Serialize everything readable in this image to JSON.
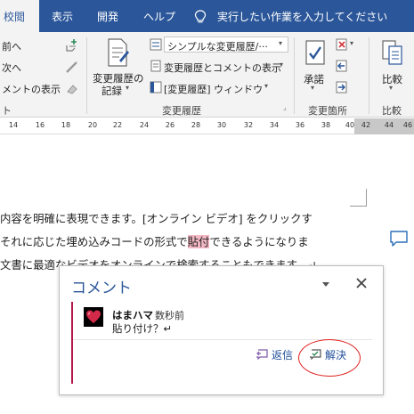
{
  "tabs": [
    {
      "label": "校閲",
      "active": true
    },
    {
      "label": "表示"
    },
    {
      "label": "開発"
    },
    {
      "label": "ヘルプ"
    }
  ],
  "tell_me": "実行したい作業を入力してください",
  "ribbon": {
    "partial_items": [
      "前へ",
      "次へ",
      "メントの表示"
    ],
    "partial_group_label": "ト",
    "track_changes": {
      "line1": "変更履歴の",
      "line2": "記録"
    },
    "markup_select": "シンプルな変更履歴/···",
    "show_markup": "変更履歴とコメントの表示",
    "reviewing_pane": "[変更履歴] ウィンドウ",
    "group_tracking": "変更履歴",
    "accept": "承諾",
    "group_changes": "変更箇所",
    "compare": "比較",
    "group_compare": "比較"
  },
  "ruler_ticks": [
    "14",
    "16",
    "18",
    "20",
    "22",
    "24",
    "26",
    "28",
    "30",
    "32",
    "34",
    "36",
    "38",
    "40",
    "42",
    "44",
    "46"
  ],
  "document": {
    "line1": "内容を明確に表現できます。[オンライン ビデオ] をクリックす",
    "line2_before": "それに応じた埋め込みコードの形式で",
    "line2_highlight": "貼付",
    "line2_after": "できるようになりま",
    "line3": "文書に最適なビデオをオンラインで検索することもできます。↵"
  },
  "comment_pane": {
    "title": "コメント",
    "author": "はまハマ",
    "time": "数秒前",
    "body": "貼り付け？↵",
    "reply": "返信",
    "resolve": "解決"
  },
  "colors": {
    "accent": "#2b579a",
    "highlight": "#f4b8c4",
    "comment_bar": "#b4184a",
    "annotation": "#e02020"
  }
}
